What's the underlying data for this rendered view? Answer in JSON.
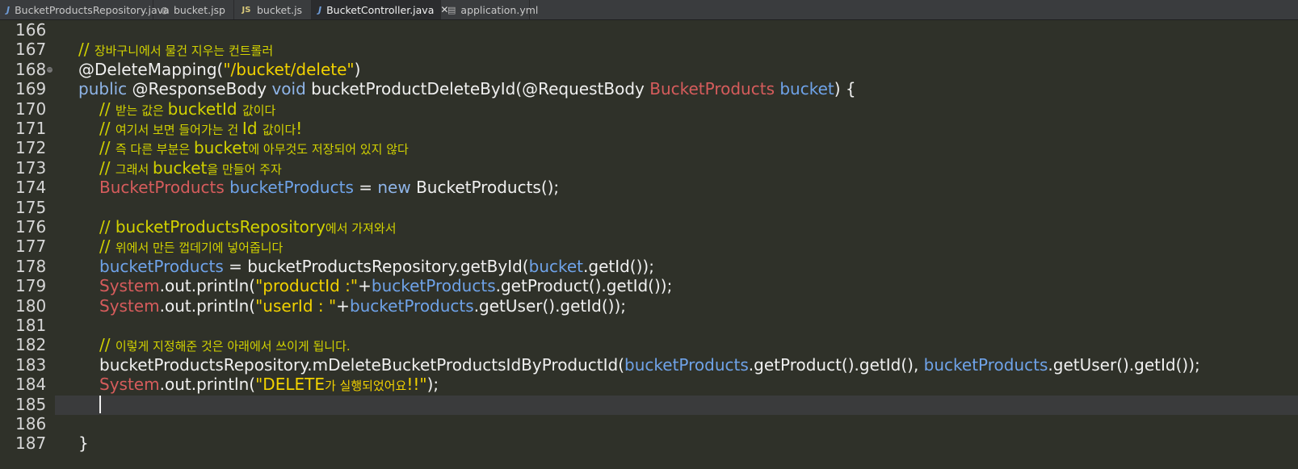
{
  "tabs": [
    {
      "name": "BucketProductsRepository.java",
      "icon": "java-file-icon",
      "glyph": "J",
      "active": false
    },
    {
      "name": "bucket.jsp",
      "icon": "jsp-file-icon",
      "glyph": "◍",
      "active": false
    },
    {
      "name": "bucket.js",
      "icon": "js-file-icon",
      "glyph": "JS",
      "active": false
    },
    {
      "name": "BucketController.java",
      "icon": "java-file-icon",
      "glyph": "J",
      "active": true,
      "close": "✕"
    },
    {
      "name": "application.yml",
      "icon": "yml-file-icon",
      "glyph": "▤",
      "active": false
    }
  ],
  "current_line": "185",
  "lines": [
    {
      "n": "166",
      "indent": 0,
      "tokens": []
    },
    {
      "n": "167",
      "indent": 1,
      "tokens": [
        {
          "t": "cmt",
          "v": "// "
        },
        {
          "t": "cmtk",
          "v": "장바구니에서 물건 지우는 컨트롤러"
        }
      ]
    },
    {
      "n": "168",
      "indent": 1,
      "fold": true,
      "tokens": [
        {
          "t": "pl",
          "v": "@DeleteMapping("
        },
        {
          "t": "str",
          "v": "\"/bucket/delete\""
        },
        {
          "t": "pl",
          "v": ")"
        }
      ]
    },
    {
      "n": "169",
      "indent": 1,
      "tokens": [
        {
          "t": "kw",
          "v": "public "
        },
        {
          "t": "pl",
          "v": "@ResponseBody "
        },
        {
          "t": "kw",
          "v": "void "
        },
        {
          "t": "pl",
          "v": "bucketProductDeleteById(@RequestBody "
        },
        {
          "t": "ty",
          "v": "BucketProducts "
        },
        {
          "t": "var",
          "v": "bucket"
        },
        {
          "t": "pl",
          "v": ") {"
        }
      ]
    },
    {
      "n": "170",
      "indent": 2,
      "tokens": [
        {
          "t": "cmt",
          "v": "// "
        },
        {
          "t": "cmtk",
          "v": "받는 값은 "
        },
        {
          "t": "cmt",
          "v": "bucketId "
        },
        {
          "t": "cmtk",
          "v": "값이다"
        }
      ]
    },
    {
      "n": "171",
      "indent": 2,
      "tokens": [
        {
          "t": "cmt",
          "v": "// "
        },
        {
          "t": "cmtk",
          "v": "여기서 보면 들어가는 건 "
        },
        {
          "t": "cmt",
          "v": "Id "
        },
        {
          "t": "cmtk",
          "v": "값이다"
        },
        {
          "t": "cmt",
          "v": "!"
        }
      ]
    },
    {
      "n": "172",
      "indent": 2,
      "tokens": [
        {
          "t": "cmt",
          "v": "// "
        },
        {
          "t": "cmtk",
          "v": "즉 다른 부분은 "
        },
        {
          "t": "cmt",
          "v": "bucket"
        },
        {
          "t": "cmtk",
          "v": "에 아무것도 저장되어 있지 않다"
        }
      ]
    },
    {
      "n": "173",
      "indent": 2,
      "tokens": [
        {
          "t": "cmt",
          "v": "// "
        },
        {
          "t": "cmtk",
          "v": "그래서 "
        },
        {
          "t": "cmt",
          "v": "bucket"
        },
        {
          "t": "cmtk",
          "v": "을 만들어 주자"
        }
      ]
    },
    {
      "n": "174",
      "indent": 2,
      "tokens": [
        {
          "t": "ty",
          "v": "BucketProducts "
        },
        {
          "t": "var",
          "v": "bucketProducts"
        },
        {
          "t": "pl",
          "v": " = "
        },
        {
          "t": "kw",
          "v": "new "
        },
        {
          "t": "pl",
          "v": "BucketProducts();"
        }
      ]
    },
    {
      "n": "175",
      "indent": 0,
      "tokens": []
    },
    {
      "n": "176",
      "indent": 2,
      "tokens": [
        {
          "t": "cmt",
          "v": "// bucketProductsRepository"
        },
        {
          "t": "cmtk",
          "v": "에서 가져와서"
        }
      ]
    },
    {
      "n": "177",
      "indent": 2,
      "tokens": [
        {
          "t": "cmt",
          "v": "// "
        },
        {
          "t": "cmtk",
          "v": "위에서 만든 껍데기에 넣어줍니다"
        }
      ]
    },
    {
      "n": "178",
      "indent": 2,
      "tokens": [
        {
          "t": "var",
          "v": "bucketProducts"
        },
        {
          "t": "pl",
          "v": " = bucketProductsRepository.getById("
        },
        {
          "t": "var",
          "v": "bucket"
        },
        {
          "t": "pl",
          "v": ".getId());"
        }
      ]
    },
    {
      "n": "179",
      "indent": 2,
      "tokens": [
        {
          "t": "ty",
          "v": "System"
        },
        {
          "t": "pl",
          "v": ".out.println("
        },
        {
          "t": "str",
          "v": "\"productId :\""
        },
        {
          "t": "pl",
          "v": "+"
        },
        {
          "t": "var",
          "v": "bucketProducts"
        },
        {
          "t": "pl",
          "v": ".getProduct().getId());"
        }
      ]
    },
    {
      "n": "180",
      "indent": 2,
      "tokens": [
        {
          "t": "ty",
          "v": "System"
        },
        {
          "t": "pl",
          "v": ".out.println("
        },
        {
          "t": "str",
          "v": "\"userId : \""
        },
        {
          "t": "pl",
          "v": "+"
        },
        {
          "t": "var",
          "v": "bucketProducts"
        },
        {
          "t": "pl",
          "v": ".getUser().getId());"
        }
      ]
    },
    {
      "n": "181",
      "indent": 0,
      "tokens": []
    },
    {
      "n": "182",
      "indent": 2,
      "tokens": [
        {
          "t": "cmt",
          "v": "// "
        },
        {
          "t": "cmtk",
          "v": "이렇게 지정해준 것은 아래에서 쓰이게 됩니다."
        }
      ]
    },
    {
      "n": "183",
      "indent": 2,
      "tokens": [
        {
          "t": "pl",
          "v": "bucketProductsRepository.mDeleteBucketProductsIdByProductId("
        },
        {
          "t": "var",
          "v": "bucketProducts"
        },
        {
          "t": "pl",
          "v": ".getProduct().getId(), "
        },
        {
          "t": "var",
          "v": "bucketProducts"
        },
        {
          "t": "pl",
          "v": ".getUser().getId());"
        }
      ]
    },
    {
      "n": "184",
      "indent": 2,
      "tokens": [
        {
          "t": "ty",
          "v": "System"
        },
        {
          "t": "pl",
          "v": ".out.println("
        },
        {
          "t": "str",
          "v": "\"DELETE"
        },
        {
          "t": "strk",
          "v": "가 실행되었어요"
        },
        {
          "t": "str",
          "v": "!!\""
        },
        {
          "t": "pl",
          "v": ");"
        }
      ]
    },
    {
      "n": "185",
      "indent": 0,
      "tokens": []
    },
    {
      "n": "186",
      "indent": 0,
      "tokens": []
    },
    {
      "n": "187",
      "indent": 1,
      "tokens": [
        {
          "t": "pl",
          "v": "}"
        }
      ]
    }
  ]
}
